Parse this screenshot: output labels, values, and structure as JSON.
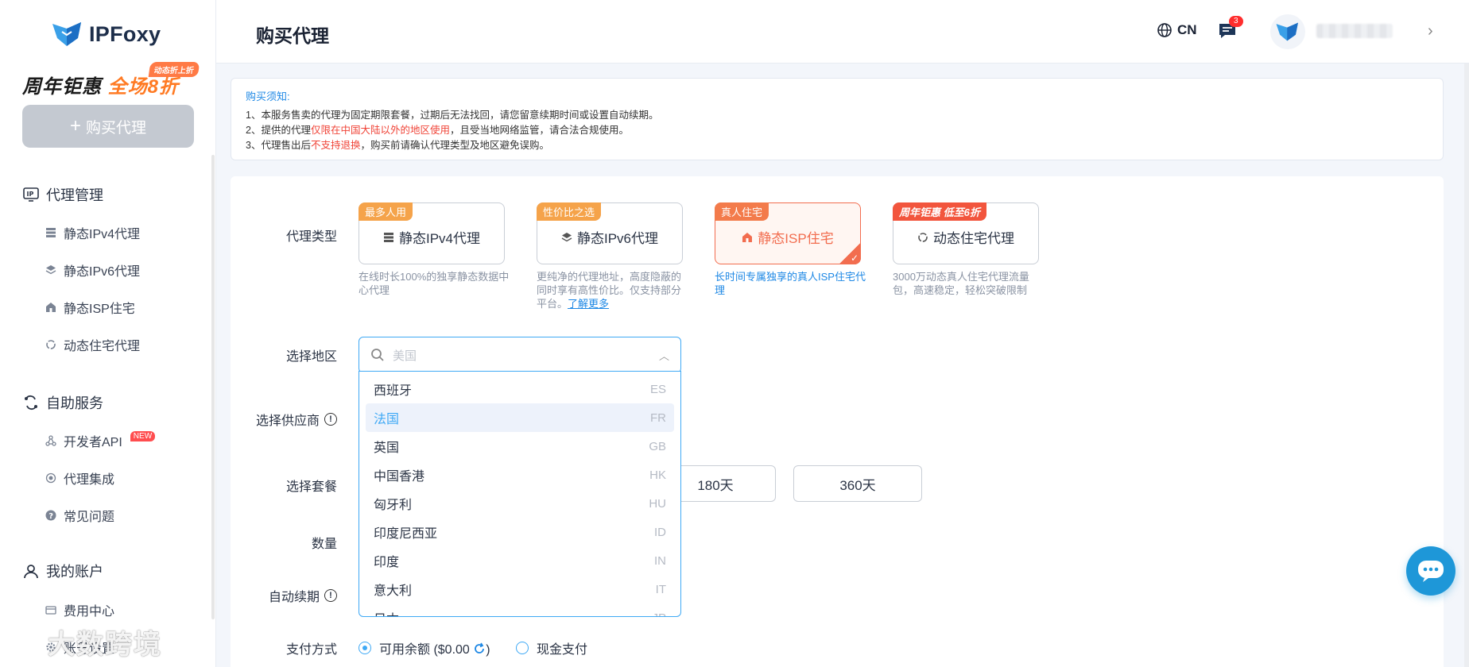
{
  "brand": {
    "name": "IPFoxy"
  },
  "promo": {
    "tag": "动态折上折",
    "text_a": "周年钜惠",
    "text_b": "全场8折"
  },
  "sidebar": {
    "buy_button": "购买代理",
    "sections": [
      {
        "label": "代理管理",
        "icon": "ip-icon"
      },
      {
        "label": "自助服务",
        "icon": "self-service-icon"
      },
      {
        "label": "我的账户",
        "icon": "user-icon"
      }
    ],
    "items": [
      {
        "label": "静态IPv4代理",
        "icon": "server-icon"
      },
      {
        "label": "静态IPv6代理",
        "icon": "layers-icon"
      },
      {
        "label": "静态ISP住宅",
        "icon": "home-icon"
      },
      {
        "label": "动态住宅代理",
        "icon": "refresh-icon"
      },
      {
        "label": "开发者API",
        "icon": "api-icon",
        "badge": "NEW"
      },
      {
        "label": "代理集成",
        "icon": "integration-icon"
      },
      {
        "label": "常见问题",
        "icon": "question-icon"
      },
      {
        "label": "费用中心",
        "icon": "card-icon"
      },
      {
        "label": "账号设置",
        "icon": "gear-icon"
      }
    ]
  },
  "watermark": "大数跨境",
  "header": {
    "title": "购买代理",
    "lang": "CN",
    "msg_count": "3"
  },
  "notice": {
    "title": "购买须知:",
    "line1": "1、本服务售卖的代理为固定期限套餐，过期后无法找回，请您留意续期时间或设置自动续期。",
    "line2_a": "2、提供的代理",
    "line2_red": "仅限在中国大陆以外的地区使用",
    "line2_b": "，且受当地网络监管，请合法合规使用。",
    "line3_a": "3、代理售出后",
    "line3_red": "不支持退换",
    "line3_b": "，购买前请确认代理类型及地区避免误购。"
  },
  "form": {
    "proxy_type_label": "代理类型",
    "region_label": "选择地区",
    "supplier_label": "选择供应商",
    "package_label": "选择套餐",
    "quantity_label": "数量",
    "auto_renew_label": "自动续期",
    "payment_label": "支付方式",
    "region_placeholder": "美国"
  },
  "proxy_types": [
    {
      "tag": "最多人用",
      "name": "静态IPv4代理",
      "desc": "在线时长100%的独享静态数据中心代理"
    },
    {
      "tag": "性价比之选",
      "name": "静态IPv6代理",
      "desc_a": "更纯净的代理地址，高度隐蔽的同时享有高性价比。仅支持部分平台。",
      "link": "了解更多"
    },
    {
      "tag": "真人住宅",
      "name": "静态ISP住宅",
      "desc": "长时间专属独享的真人ISP住宅代理"
    },
    {
      "tag": "周年钜惠 低至6折",
      "name": "动态住宅代理",
      "desc": "3000万动态真人住宅代理流量包，高速稳定，轻松突破限制"
    }
  ],
  "regions": [
    {
      "name": "西班牙",
      "code": "ES"
    },
    {
      "name": "法国",
      "code": "FR"
    },
    {
      "name": "英国",
      "code": "GB"
    },
    {
      "name": "中国香港",
      "code": "HK"
    },
    {
      "name": "匈牙利",
      "code": "HU"
    },
    {
      "name": "印度尼西亚",
      "code": "ID"
    },
    {
      "name": "印度",
      "code": "IN"
    },
    {
      "name": "意大利",
      "code": "IT"
    },
    {
      "name": "日本",
      "code": "JP"
    }
  ],
  "packages": [
    "180天",
    "360天"
  ],
  "payment": {
    "balance_a": "可用余额 ($0.00",
    "balance_b": ")",
    "cash": "现金支付"
  }
}
